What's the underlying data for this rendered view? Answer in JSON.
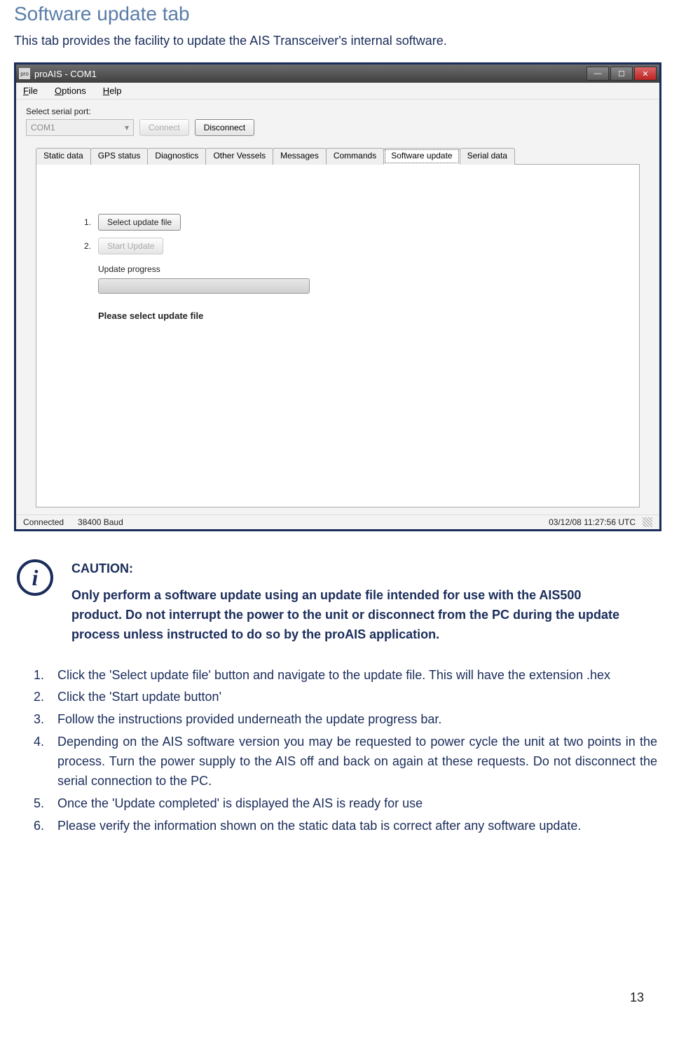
{
  "section_title": "Software update tab",
  "intro": "This tab provides the facility to update the AIS Transceiver's internal software.",
  "app": {
    "title": "proAIS - COM1",
    "menu": {
      "file": "File",
      "options": "Options",
      "help": "Help"
    },
    "serial_label": "Select serial port:",
    "port_value": "COM1",
    "connect": "Connect",
    "disconnect": "Disconnect",
    "tabs": [
      "Static data",
      "GPS status",
      "Diagnostics",
      "Other Vessels",
      "Messages",
      "Commands",
      "Software update",
      "Serial data"
    ],
    "active_tab_index": 6,
    "row1_num": "1.",
    "row2_num": "2.",
    "select_file_btn": "Select update file",
    "start_update_btn": "Start Update",
    "progress_label": "Update progress",
    "status_msg": "Please select update file",
    "status_left": [
      "Connected",
      "38400 Baud"
    ],
    "status_right": "03/12/08  11:27:56 UTC"
  },
  "caution": {
    "heading": "CAUTION:",
    "body": "Only perform a software update using an update file intended for use with the AIS500 product. Do not interrupt the power to the unit or disconnect from the PC during the update process unless instructed to do so by the proAIS application."
  },
  "steps": [
    "Click the 'Select update file' button and navigate to the update file. This will have the extension .hex",
    "Click the 'Start update button'",
    "Follow the instructions provided underneath the update progress bar.",
    "Depending on the AIS software version you may be requested to power cycle the unit at two points in the process. Turn the power supply to the AIS off and back on again at these requests. Do not disconnect the serial connection to the PC.",
    "Once the 'Update completed' is displayed the AIS is ready for use",
    "Please verify the information shown on the static data tab is correct after any software update."
  ],
  "page_number": "13"
}
